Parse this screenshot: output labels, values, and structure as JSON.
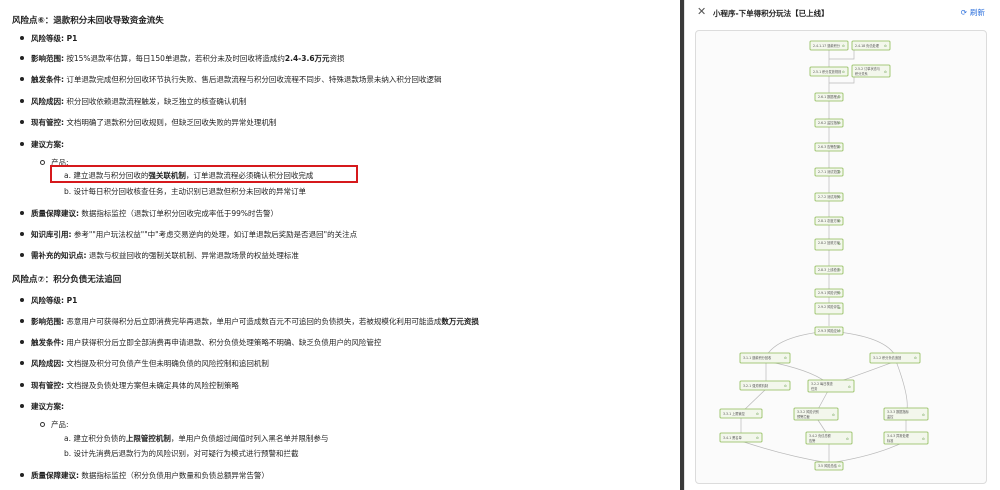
{
  "doc": {
    "section1": {
      "title": "风险点⑥：退款积分未回收导致资金流失",
      "level_label": "风险等级:",
      "level_value": " P1",
      "impact_label": "影响范围:",
      "impact_text": " 按15%退款率估算，每日150单退款，若积分未及时回收将造成约",
      "impact_bold": "2.4-3.6万元",
      "impact_tail": "资损",
      "trigger_label": "触发条件:",
      "trigger_text": " 订单退款完成但积分回收环节执行失败、售后退款流程与积分回收流程不同步、特殊退款场景未纳入积分回收逻辑",
      "cause_label": "风险成因:",
      "cause_text": " 积分回收依赖退款流程触发，缺乏独立的核查确认机制",
      "control_label": "现有管控:",
      "control_text": " 文档明确了退款积分回收规则，但缺乏回收失败的异常处理机制",
      "suggest_label": "建议方案:",
      "product_label": "产品:",
      "a_prefix": "a. 建立退款与积分回收的",
      "a_bold": "强关联机制",
      "a_tail": "，订单退款流程必须确认积分回收完成",
      "b_text": "b. 设计每日积分回收核查任务，主动识别已退款但积分未回收的异常订单",
      "quality_label": "质量保障建议:",
      "quality_text": " 数据指标监控（退款订单积分回收完成率低于99%时告警）",
      "kb_label": "知识库引用:",
      "kb_text": " 参考\"\"用户玩法权益\"\"中\"考虑交易逆向的处理，如订单退款后奖励是否退回\"的关注点",
      "need_label": "需补充的知识点:",
      "need_text": " 退款与权益回收的强制关联机制、异常退款场景的权益处理标准"
    },
    "section2": {
      "title": "风险点⑦：积分负债无法追回",
      "level_label": "风险等级:",
      "level_value": " P1",
      "impact_label": "影响范围:",
      "impact_text": " 恶意用户可获得积分后立即消费完毕再退款，单用户可造成数百元不可追回的负债损失，若被规模化利用可能造成",
      "impact_bold": "数万元资损",
      "trigger_label": "触发条件:",
      "trigger_text": " 用户获得积分后立即全部消费再申请退款、积分负债处理策略不明确、缺乏负债用户的风险管控",
      "cause_label": "风险成因:",
      "cause_text": " 文档提及积分可负债产生但未明确负债的风险控制和追回机制",
      "control_label": "现有管控:",
      "control_text": " 文档提及负债处理方案但未确定具体的风险控制策略",
      "suggest_label": "建议方案:",
      "product_label": "产品:",
      "a_prefix": "a. 建立积分负债的",
      "a_bold": "上限管控机制",
      "a_tail": "，单用户负债超过阈值时列入黑名单并限制参与",
      "b_text": "b. 设计先消费后退款行为的风险识别，对可疑行为模式进行预警和拦截",
      "quality_label": "质量保障建议:",
      "quality_text": " 数据指标监控（积分负债用户数量和负债总额异常告警）"
    }
  },
  "panel": {
    "title": "小程序-下单得积分玩法【已上线】",
    "refresh_label": "刷新",
    "close_icon": "close-icon",
    "refresh_icon": "refresh-icon"
  },
  "colors": {
    "highlight_border": "#d6191c",
    "link_blue": "#2b6fdc",
    "node_fill": "#f3f7ec",
    "node_stroke": "#8dbb55"
  }
}
